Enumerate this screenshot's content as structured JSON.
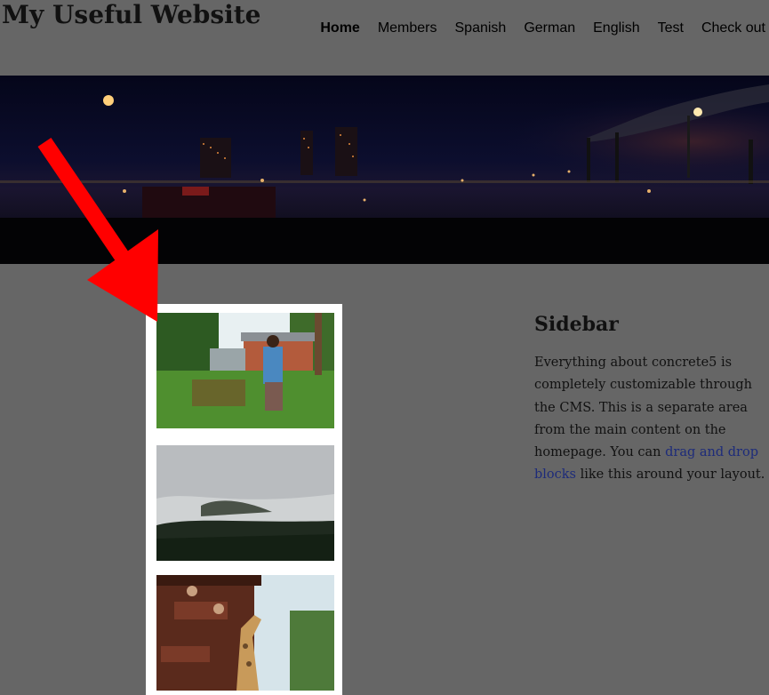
{
  "site": {
    "title": "My Useful Website"
  },
  "nav": {
    "items": [
      {
        "label": "Home",
        "active": true
      },
      {
        "label": "Members"
      },
      {
        "label": "Spanish"
      },
      {
        "label": "German"
      },
      {
        "label": "English"
      },
      {
        "label": "Test"
      },
      {
        "label": "Check out"
      }
    ]
  },
  "colors": {
    "background": "#666666",
    "arrow": "#ff0000",
    "link": "#1d2b7a"
  },
  "sidebar": {
    "title": "Sidebar",
    "text_before": "Everything about concrete5 is completely customizable through the CMS. This is a separate area from the main content on the homepage. You can ",
    "link_text": "drag and drop blocks",
    "text_after": " like this around your layout."
  }
}
